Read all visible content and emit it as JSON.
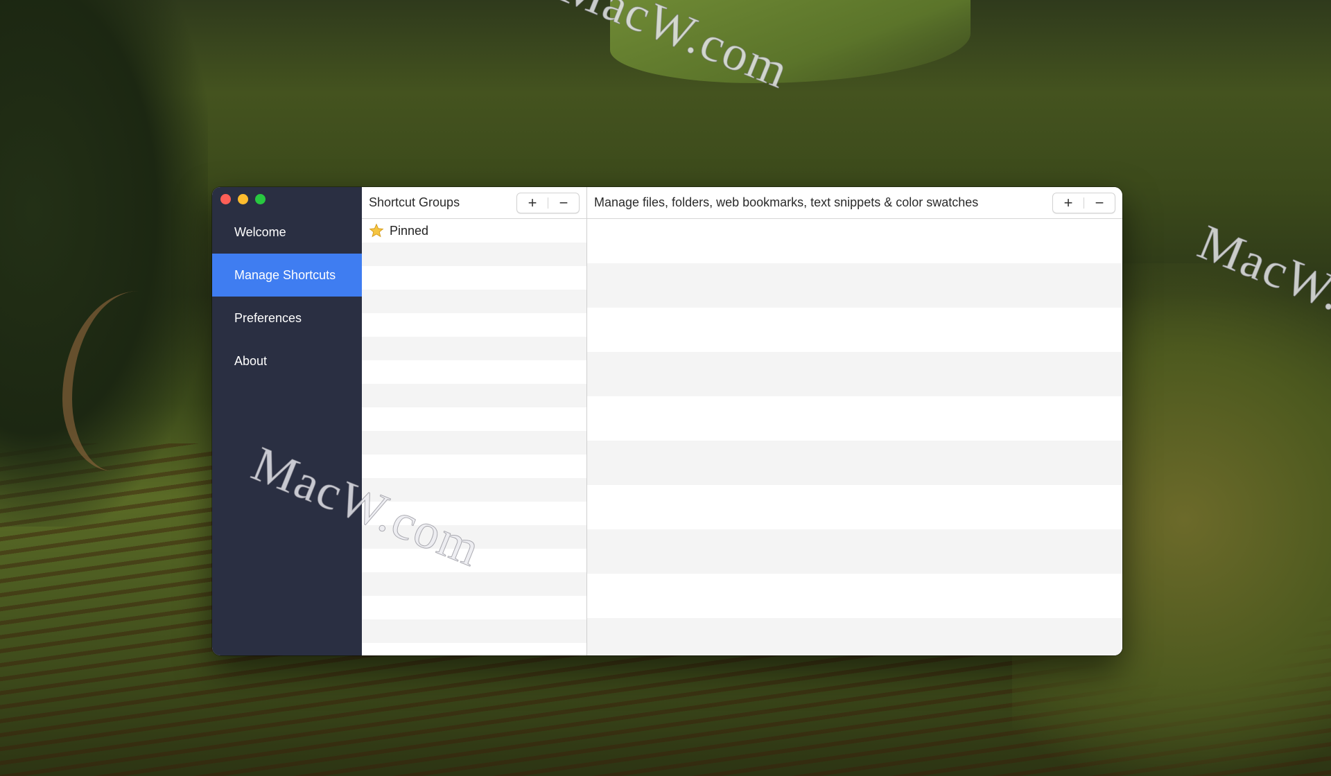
{
  "watermark": "MacW.com",
  "sidebar": {
    "items": [
      {
        "label": "Welcome",
        "active": false
      },
      {
        "label": "Manage Shortcuts",
        "active": true
      },
      {
        "label": "Preferences",
        "active": false
      },
      {
        "label": "About",
        "active": false
      }
    ]
  },
  "groups_pane": {
    "title": "Shortcut Groups",
    "add_label": "+",
    "remove_label": "−",
    "items": [
      {
        "label": "Pinned",
        "icon": "star-icon"
      }
    ]
  },
  "shortcuts_pane": {
    "title": "Manage files, folders, web bookmarks, text snippets & color swatches",
    "add_label": "+",
    "remove_label": "−"
  },
  "colors": {
    "sidebar_bg": "#2a2f42",
    "accent": "#3f7df1",
    "close": "#fe5f57",
    "minimize": "#febc2e",
    "zoom": "#28c840",
    "star": "#f5c542"
  }
}
